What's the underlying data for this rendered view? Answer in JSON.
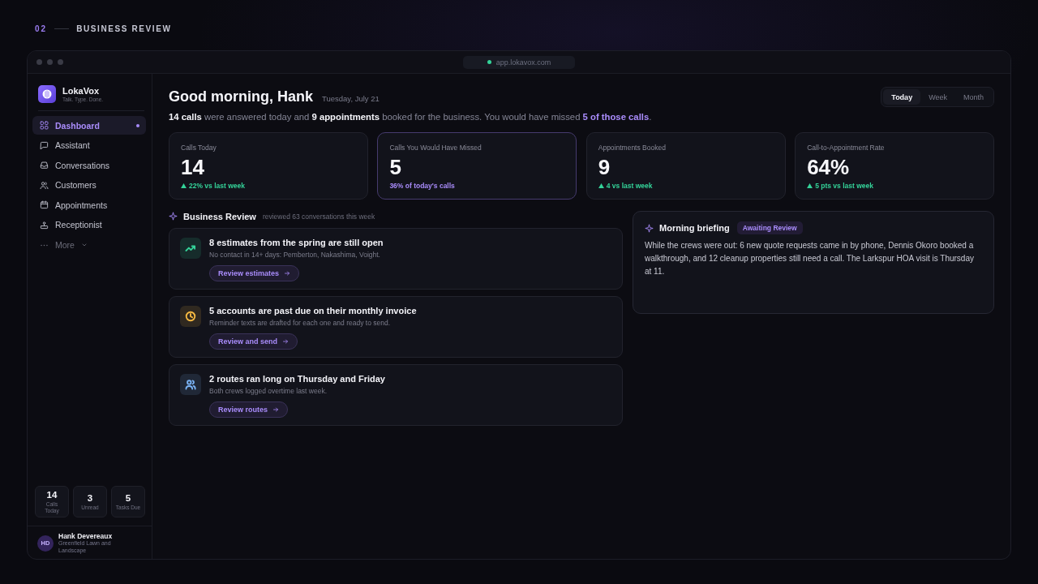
{
  "section": {
    "number": "02",
    "title": "BUSINESS REVIEW"
  },
  "browser": {
    "url": "app.lokavox.com"
  },
  "sidebar": {
    "brand": {
      "name": "LokaVox",
      "tagline": "Talk. Type. Done."
    },
    "nav": [
      {
        "label": "Dashboard",
        "kind": "link",
        "selected": true
      },
      {
        "label": "Assistant",
        "kind": "link",
        "selected": false
      },
      {
        "label": "Conversations",
        "kind": "link",
        "selected": false
      },
      {
        "label": "Customers",
        "kind": "link",
        "selected": false
      },
      {
        "label": "Appointments",
        "kind": "link",
        "selected": false
      },
      {
        "label": "Receptionist",
        "kind": "link",
        "selected": false
      },
      {
        "label": "More",
        "kind": "more",
        "selected": false
      }
    ],
    "stats": [
      {
        "value": "14",
        "label": "Calls Today"
      },
      {
        "value": "3",
        "label": "Unread"
      },
      {
        "value": "5",
        "label": "Tasks Due"
      }
    ],
    "user": {
      "initials": "HD",
      "name": "Hank Devereaux",
      "company": "Greenfield Lawn and Landscape"
    }
  },
  "header": {
    "greeting": "Good morning, Hank",
    "date": "Tuesday, July 21",
    "range_tabs": [
      {
        "label": "Today",
        "selected": true
      },
      {
        "label": "Week",
        "selected": false
      },
      {
        "label": "Month",
        "selected": false
      }
    ]
  },
  "summary": [
    {
      "text": "14 calls",
      "kind": "strong"
    },
    {
      "text": "were answered today and",
      "kind": "plain"
    },
    {
      "text": "9 appointments",
      "kind": "strong"
    },
    {
      "text": "booked for the business. You would have missed",
      "kind": "plain"
    },
    {
      "text": "5 of those calls",
      "kind": "accent"
    },
    {
      "text": ".",
      "kind": "tail"
    }
  ],
  "stats": [
    {
      "label": "Calls Today",
      "value": "14",
      "note": "22% vs last week",
      "kind": "up",
      "highlighted": false
    },
    {
      "label": "Calls You Would Have Missed",
      "value": "5",
      "note": "36% of today's calls",
      "kind": "share",
      "highlighted": true
    },
    {
      "label": "Appointments Booked",
      "value": "9",
      "note": "4 vs last week",
      "kind": "up",
      "highlighted": false
    },
    {
      "label": "Call-to-Appointment Rate",
      "value": "64%",
      "note": "5 pts vs last week",
      "kind": "up",
      "highlighted": false
    }
  ],
  "review": {
    "title": "Business Review",
    "subtitle": "reviewed 63 conversations this week",
    "items": [
      {
        "title": "8 estimates from the spring are still open",
        "description": "No contact in 14+ days: Pemberton, Nakashima, Voight.",
        "action": "Review estimates",
        "color": "#34d399"
      },
      {
        "title": "5 accounts are past due on their monthly invoice",
        "description": "Reminder texts are drafted for each one and ready to send.",
        "action": "Review and send",
        "color": "#f5b942"
      },
      {
        "title": "2 routes ran long on Thursday and Friday",
        "description": "Both crews logged overtime last week.",
        "action": "Review routes",
        "color": "#7ab3f5"
      }
    ]
  },
  "briefing": {
    "title": "Morning briefing",
    "badge": "Awaiting Review",
    "text": "While the crews were out: 6 new quote requests came in by phone, Dennis Okoro booked a walkthrough, and 12 cleanup properties still need a call. The Larkspur HOA visit is Thursday at 11."
  }
}
